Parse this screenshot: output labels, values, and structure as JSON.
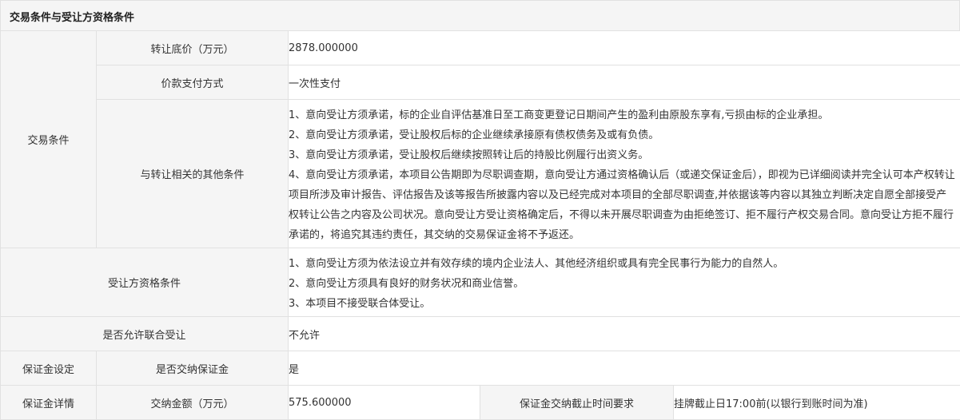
{
  "section_title": "交易条件与受让方资格条件",
  "trade_conditions": {
    "group_label": "交易条件",
    "transfer_base_price": {
      "label": "转让底价（万元）",
      "value": "2878.000000"
    },
    "payment_method": {
      "label": "价款支付方式",
      "value": "一次性支付"
    },
    "other_conditions": {
      "label": "与转让相关的其他条件",
      "items": [
        "1、意向受让方须承诺，标的企业自评估基准日至工商变更登记日期间产生的盈利由原股东享有,亏损由标的企业承担。",
        "2、意向受让方须承诺，受让股权后标的企业继续承接原有债权债务及或有负债。",
        "3、意向受让方须承诺，受让股权后继续按照转让后的持股比例履行出资义务。",
        "4、意向受让方须承诺，本项目公告期即为尽职调查期，意向受让方通过资格确认后（或递交保证金后），即视为已详细阅读并完全认可本产权转让项目所涉及审计报告、评估报告及该等报告所披露内容以及已经完成对本项目的全部尽职调查,并依据该等内容以其独立判断决定自愿全部接受产权转让公告之内容及公司状况。意向受让方受让资格确定后，不得以未开展尽职调查为由拒绝签订、拒不履行产权交易合同。意向受让方拒不履行承诺的，将追究其违约责任，其交纳的交易保证金将不予返还。"
      ]
    }
  },
  "qualification": {
    "label": "受让方资格条件",
    "items": [
      "1、意向受让方须为依法设立并有效存续的境内企业法人、其他经济组织或具有完全民事行为能力的自然人。",
      "2、意向受让方须具有良好的财务状况和商业信誉。",
      "3、本项目不接受联合体受让。"
    ]
  },
  "joint_bid": {
    "label": "是否允许联合受让",
    "value": "不允许"
  },
  "deposit_setting": {
    "group_label": "保证金设定",
    "label": "是否交纳保证金",
    "value": "是"
  },
  "deposit_details": {
    "group_label": "保证金详情",
    "amount_label": "交纳金额（万元）",
    "amount_value": "575.600000",
    "deadline_label": "保证金交纳截止时间要求",
    "deadline_value": "挂牌截止日17:00前(以银行到账时间为准)"
  }
}
